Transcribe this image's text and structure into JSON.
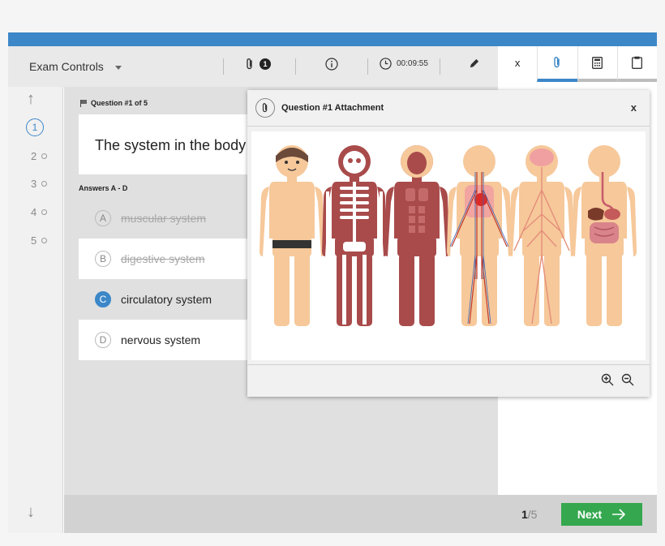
{
  "toolbar": {
    "exam_controls": "Exam Controls",
    "attachment_count": "1",
    "timer": "00:09:55"
  },
  "right_tabs": {
    "close": "x"
  },
  "sidebar": {
    "questions": [
      {
        "number": "1",
        "current": true
      },
      {
        "number": "2"
      },
      {
        "number": "3"
      },
      {
        "number": "4"
      },
      {
        "number": "5"
      }
    ]
  },
  "question": {
    "header": "Question #1 of 5",
    "text": "The system in the body",
    "answers_label": "Answers A - D",
    "answers": [
      {
        "letter": "A",
        "text": "muscular system",
        "state": "struck"
      },
      {
        "letter": "B",
        "text": "digestive system",
        "state": "struck"
      },
      {
        "letter": "C",
        "text": "circulatory system",
        "state": "selected"
      },
      {
        "letter": "D",
        "text": "nervous system",
        "state": "normal"
      }
    ]
  },
  "attachment": {
    "title": "Question #1 Attachment",
    "close": "x",
    "figures": [
      "skin",
      "skeletal",
      "muscular",
      "circulatory",
      "nervous",
      "digestive"
    ]
  },
  "footer": {
    "page_current": "1",
    "page_total": "/5",
    "next_label": "Next"
  },
  "colors": {
    "accent": "#3c87c8",
    "next": "#35a84f",
    "skin": "#f6c89a",
    "organ": "#a94b4b"
  }
}
